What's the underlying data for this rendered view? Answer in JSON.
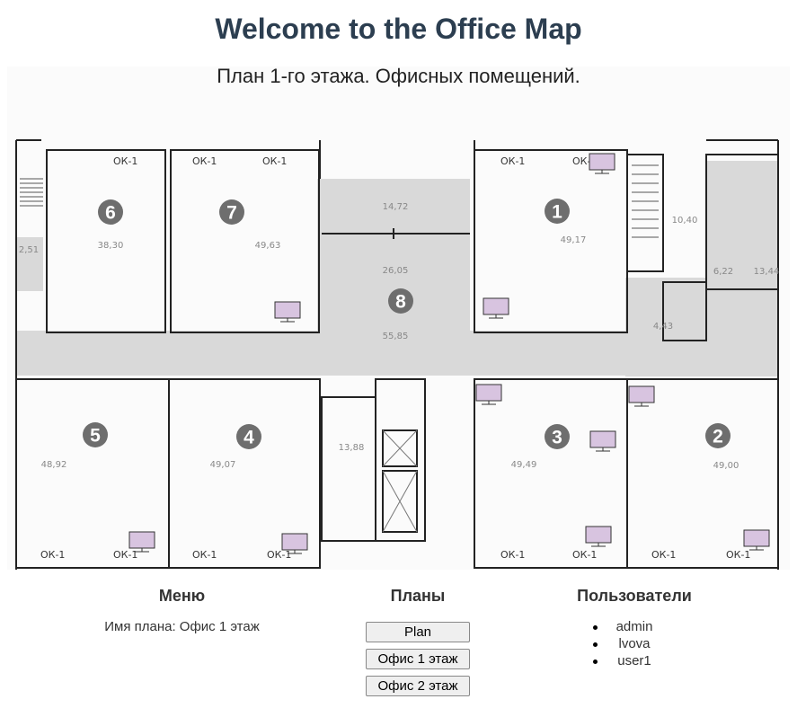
{
  "header": {
    "title": "Welcome to the Office Map",
    "plan_caption": "План 1-го этажа. Офисных помещений."
  },
  "floorplan": {
    "rooms": [
      {
        "number": "1",
        "area": "49,17"
      },
      {
        "number": "2",
        "area": "49,00"
      },
      {
        "number": "3",
        "area": "49,49"
      },
      {
        "number": "4",
        "area": "49,07"
      },
      {
        "number": "5",
        "area": "48,92"
      },
      {
        "number": "6",
        "area": "38,30"
      },
      {
        "number": "7",
        "area": "49,63"
      },
      {
        "number": "8",
        "area": "55,85"
      }
    ],
    "other_areas": [
      "14,72",
      "26,05",
      "10,40",
      "6,22",
      "13,44",
      "4,43",
      "13,88",
      "2,51"
    ],
    "window_label": "ОК-1",
    "room_marker_color": "#6e6e6e",
    "corridor_color": "#d9d9d9",
    "workstation_icon": "monitor-icon",
    "workstation_color": "#d8c4e0"
  },
  "menu": {
    "heading": "Меню",
    "plan_name_text": "Имя плана: Офис 1 этаж"
  },
  "plans": {
    "heading": "Планы",
    "buttons": [
      "Plan",
      "Офис 1 этаж",
      "Офис 2 этаж"
    ]
  },
  "users": {
    "heading": "Пользователи",
    "list": [
      "admin",
      "lvova",
      "user1"
    ]
  }
}
